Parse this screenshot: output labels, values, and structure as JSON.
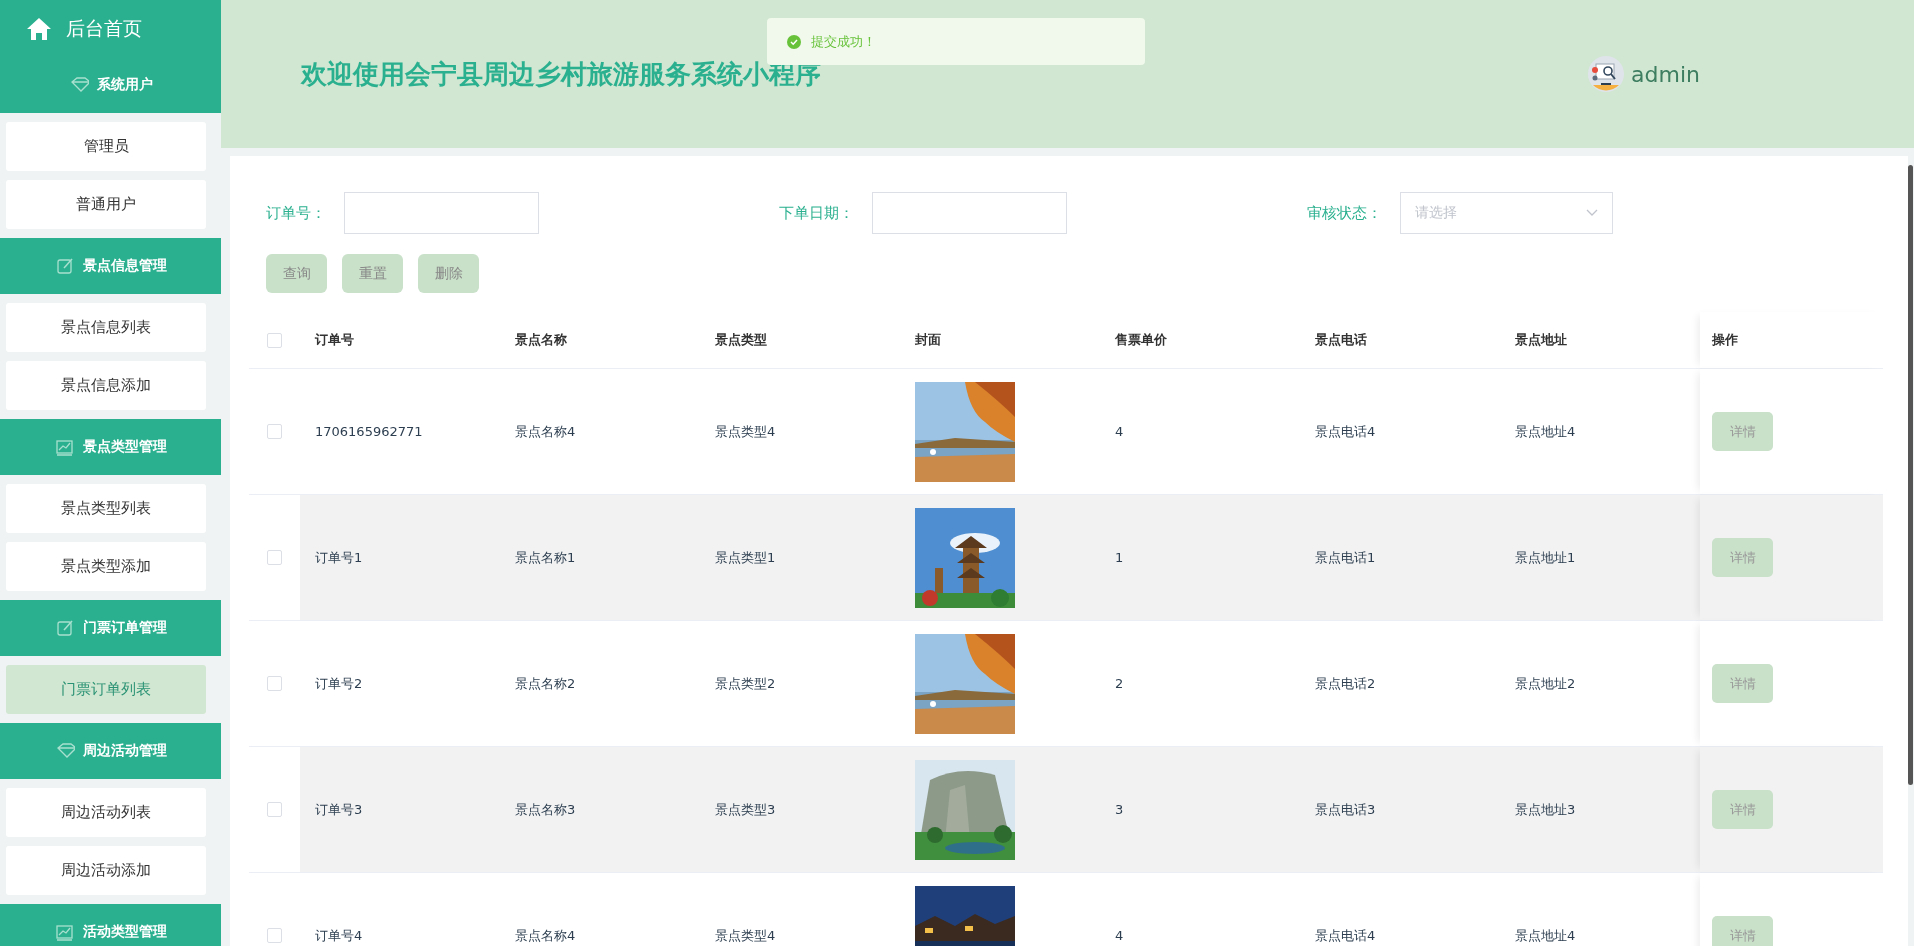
{
  "sidebar": {
    "home": "后台首页",
    "groups": [
      {
        "label": "系统用户",
        "items": [
          {
            "label": "管理员",
            "selected": false
          },
          {
            "label": "普通用户",
            "selected": false
          }
        ]
      },
      {
        "label": "景点信息管理",
        "items": [
          {
            "label": "景点信息列表",
            "selected": false
          },
          {
            "label": "景点信息添加",
            "selected": false
          }
        ]
      },
      {
        "label": "景点类型管理",
        "items": [
          {
            "label": "景点类型列表",
            "selected": false
          },
          {
            "label": "景点类型添加",
            "selected": false
          }
        ]
      },
      {
        "label": "门票订单管理",
        "items": [
          {
            "label": "门票订单列表",
            "selected": true
          }
        ]
      },
      {
        "label": "周边活动管理",
        "items": [
          {
            "label": "周边活动列表",
            "selected": false
          },
          {
            "label": "周边活动添加",
            "selected": false
          }
        ]
      },
      {
        "label": "活动类型管理"
      }
    ]
  },
  "header": {
    "title": "欢迎使用会宁县周边乡村旅游服务系统小程序",
    "user": "admin"
  },
  "toast": {
    "message": "提交成功！"
  },
  "filters": [
    {
      "kind": "text",
      "label": "订单号："
    },
    {
      "kind": "text",
      "label": "下单日期："
    },
    {
      "kind": "select",
      "label": "审核状态：",
      "placeholder": "请选择"
    }
  ],
  "buttons": [
    "查询",
    "重置",
    "删除"
  ],
  "table": {
    "select_all_checked": false,
    "columns": [
      {
        "kind": "text",
        "label": "订单号"
      },
      {
        "kind": "text",
        "label": "景点名称"
      },
      {
        "kind": "text",
        "label": "景点类型"
      },
      {
        "kind": "cover",
        "label": "封面"
      },
      {
        "kind": "text",
        "label": "售票单价"
      },
      {
        "kind": "text",
        "label": "景点电话"
      },
      {
        "kind": "text",
        "label": "景点地址"
      },
      {
        "kind": "action",
        "label": "操作"
      }
    ],
    "rows": [
      {
        "checked": false,
        "cells": [
          "1706165962771",
          "景点名称4",
          "景点类型4",
          {
            "kind": "picture"
          },
          "4",
          "景点电话4",
          "景点地址4",
          "详情"
        ]
      },
      {
        "checked": false,
        "cells": [
          "订单号1",
          "景点名称1",
          "景点类型1",
          {
            "kind": "picture"
          },
          "1",
          "景点电话1",
          "景点地址1",
          "详情"
        ]
      },
      {
        "checked": false,
        "cells": [
          "订单号2",
          "景点名称2",
          "景点类型2",
          {
            "kind": "picture"
          },
          "2",
          "景点电话2",
          "景点地址2",
          "详情"
        ]
      },
      {
        "checked": false,
        "cells": [
          "订单号3",
          "景点名称3",
          "景点类型3",
          {
            "kind": "picture"
          },
          "3",
          "景点电话3",
          "景点地址3",
          "详情"
        ]
      },
      {
        "checked": false,
        "cells": [
          "订单号4",
          "景点名称4",
          "景点类型4",
          {
            "kind": "picture"
          },
          "4",
          "景点电话4",
          "景点地址4",
          "详情"
        ]
      }
    ]
  }
}
